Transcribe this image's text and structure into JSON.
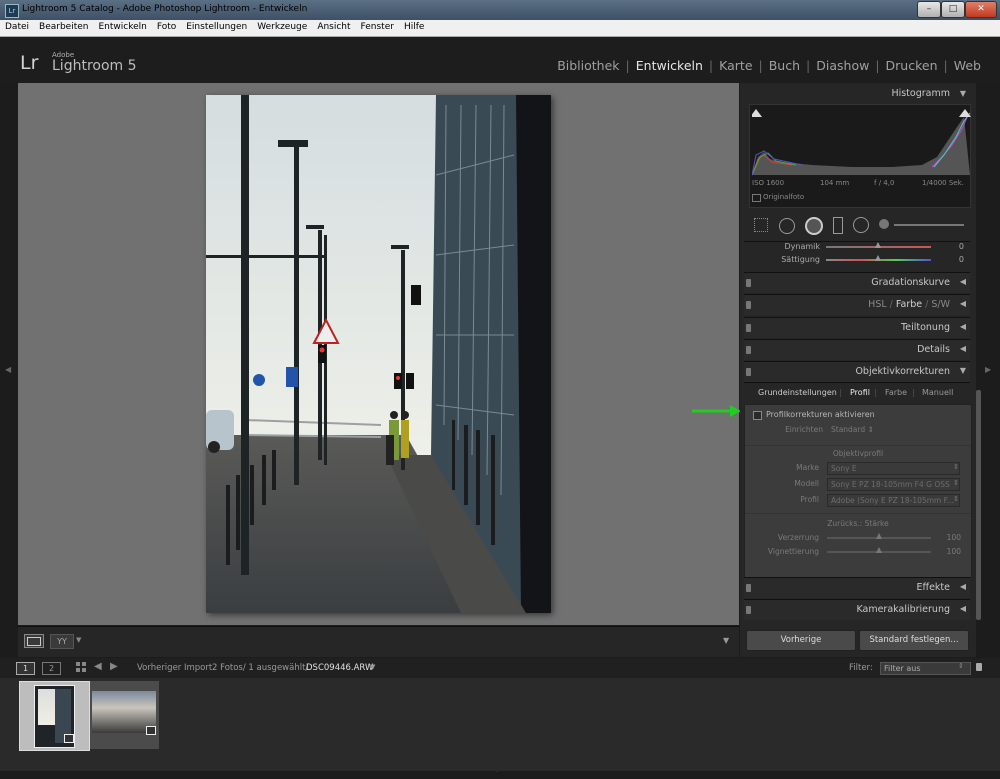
{
  "window": {
    "title": "Lightroom 5 Catalog - Adobe Photoshop Lightroom - Entwickeln",
    "icon": "Lr",
    "minimize": "–",
    "maximize": "□",
    "close": "✕"
  },
  "menu": [
    "Datei",
    "Bearbeiten",
    "Entwickeln",
    "Foto",
    "Einstellungen",
    "Werkzeuge",
    "Ansicht",
    "Fenster",
    "Hilfe"
  ],
  "brand": {
    "logo": "Lr",
    "adobe": "Adobe",
    "name": "Lightroom 5"
  },
  "modules": {
    "items": [
      "Bibliothek",
      "Entwickeln",
      "Karte",
      "Buch",
      "Diashow",
      "Drucken",
      "Web"
    ],
    "separator": "|",
    "active": "Entwickeln"
  },
  "histogram": {
    "title": "Histogramm",
    "iso": "ISO 1600",
    "focal": "104 mm",
    "aperture": "f / 4,0",
    "shutter": "1/4000 Sek.",
    "original": "Originalfoto"
  },
  "basic": {
    "dynamik_label": "Dynamik",
    "dynamik_value": "0",
    "saettigung_label": "Sättigung",
    "saettigung_value": "0"
  },
  "panels": {
    "gradation": "Gradationskurve",
    "hsl": "HSL",
    "farbe": "Farbe",
    "sw": "S/W",
    "sep": "/",
    "teiltonung": "Teiltonung",
    "details": "Details",
    "objektiv": "Objektivkorrekturen",
    "effekte": "Effekte",
    "kamera": "Kamerakalibrierung"
  },
  "lens": {
    "tabs": [
      "Grundeinstellungen",
      "Profil",
      "Farbe",
      "Manuell"
    ],
    "tab_sep": "|",
    "active_tab": "Profil",
    "enable_label": "Profilkorrekturen aktivieren",
    "setup_label": "Einrichten",
    "setup_value": "Standard ⇕",
    "profile_header": "Objektivprofil",
    "marke_label": "Marke",
    "marke_value": "Sony E",
    "modell_label": "Modell",
    "modell_value": "Sony E PZ 18-105mm F4 G OSS",
    "profil_label": "Profil",
    "profil_value": "Adobe (Sony E PZ 18-105mm F...",
    "amount_header": "Zurücks.: Stärke",
    "verzerrung_label": "Verzerrung",
    "verzerrung_value": "100",
    "vignettierung_label": "Vignettierung",
    "vignettierung_value": "100"
  },
  "buttons": {
    "previous": "Vorherige",
    "default": "Standard festlegen..."
  },
  "filmstrip": {
    "page1": "1",
    "page2": "2",
    "source": "Vorheriger Import",
    "count": "2 Fotos/ 1 ausgewählt/",
    "filename": "DSC09446.ARW",
    "filter_label": "Filter:",
    "filter_value": "Filter aus"
  },
  "colors": {
    "accent_arrow": "#22cc22",
    "background": "#1c1c1c",
    "panel": "#262626",
    "mainview": "#717171"
  }
}
